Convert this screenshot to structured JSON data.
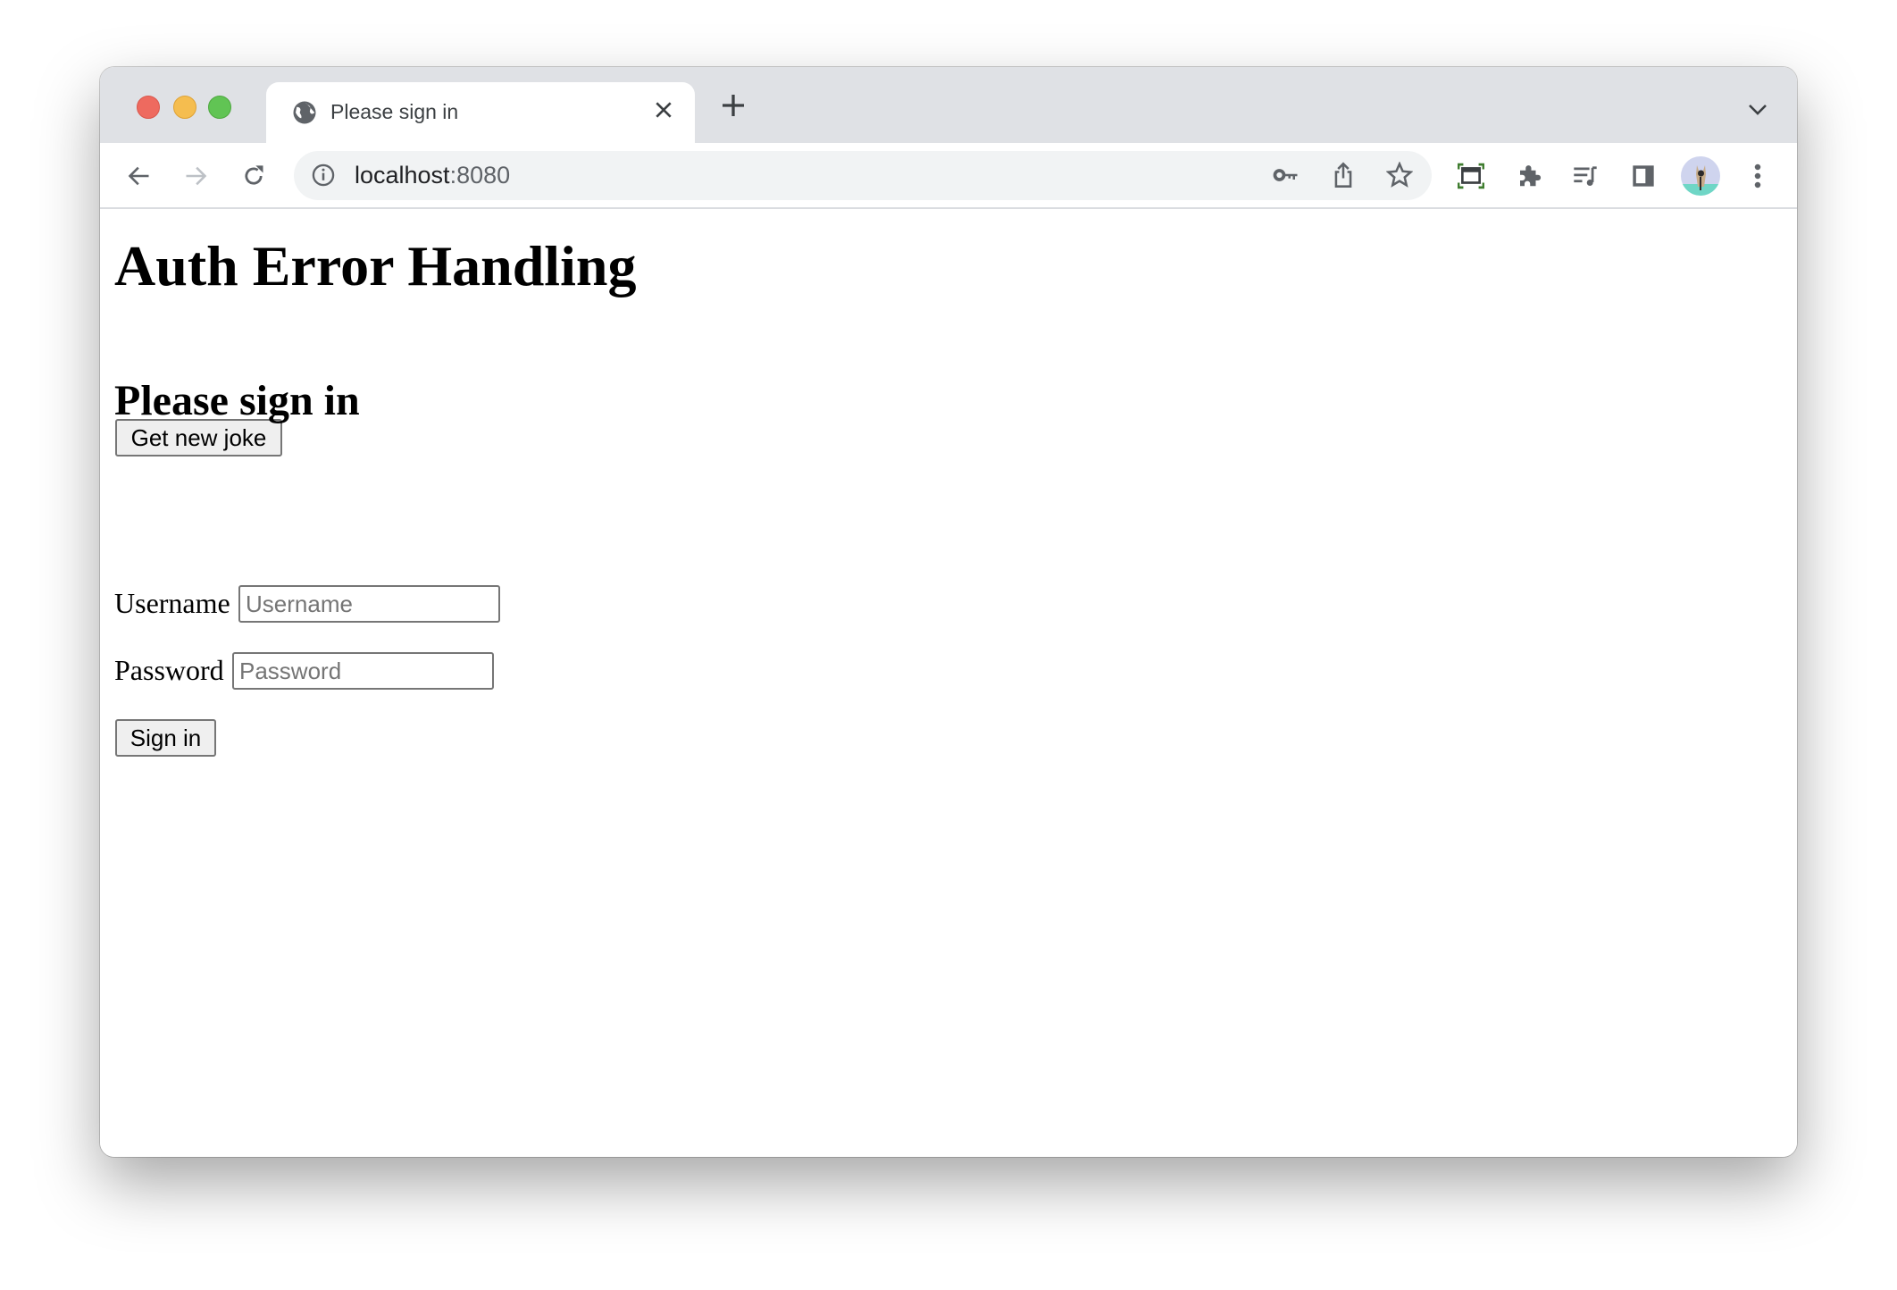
{
  "browser": {
    "tab": {
      "title": "Please sign in"
    },
    "address_bar": {
      "host": "localhost",
      "port": ":8080"
    },
    "colors": {
      "tabbar": "#dfe1e5",
      "close": "#ee6a5f",
      "minimize": "#f5bd4f",
      "maximize": "#61c454"
    },
    "icons": [
      "globe-icon",
      "close-icon",
      "plus-icon",
      "chevron-down-icon",
      "back-icon",
      "forward-icon",
      "reload-icon",
      "info-icon",
      "key-icon",
      "share-icon",
      "star-icon",
      "screenshot-icon",
      "extensions-icon",
      "media-icon",
      "side-panel-icon",
      "avatar",
      "more-icon"
    ]
  },
  "page": {
    "title": "Auth Error Handling",
    "joke_button": "Get new joke",
    "signin_heading": "Please sign in",
    "username": {
      "label": "Username",
      "placeholder": "Username",
      "value": ""
    },
    "password": {
      "label": "Password",
      "placeholder": "Password",
      "value": ""
    },
    "signin_button": "Sign in"
  }
}
